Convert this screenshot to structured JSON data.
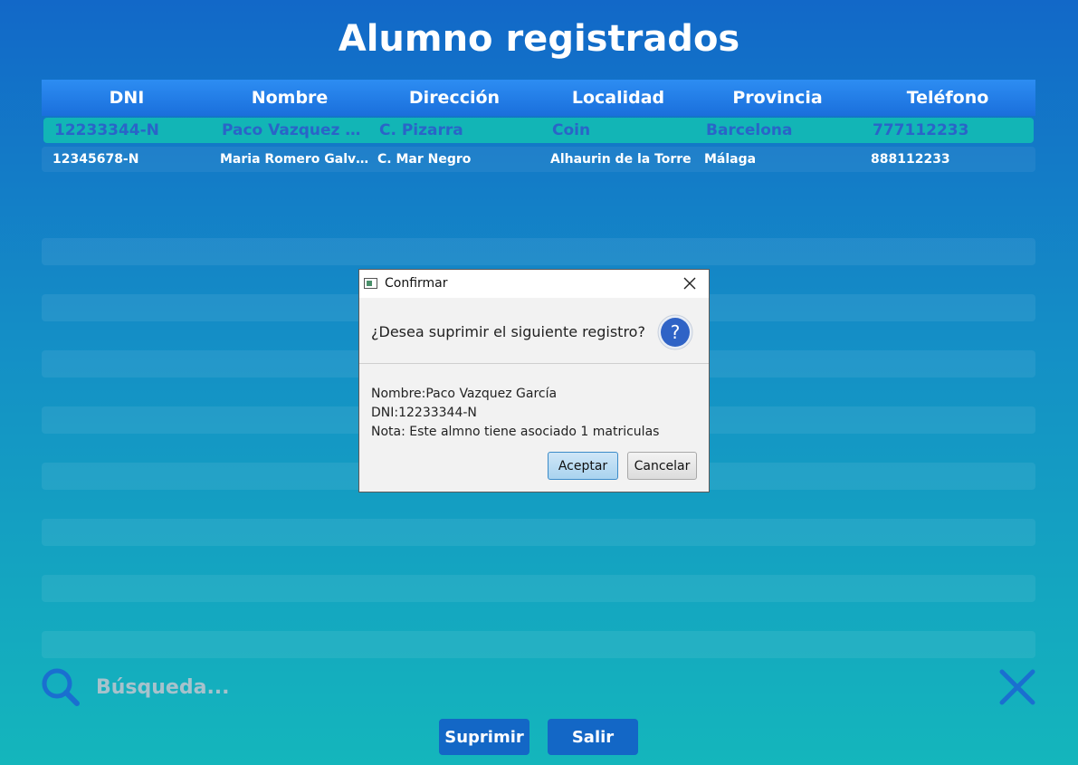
{
  "page": {
    "title": "Alumno registrados"
  },
  "table": {
    "columns": [
      "DNI",
      "Nombre",
      "Dirección",
      "Localidad",
      "Provincia",
      "Teléfono"
    ],
    "rows": [
      {
        "dni": "12233344-N",
        "nombre": "Paco Vazquez Ga...",
        "direccion": "C. Pizarra",
        "localidad": "Coin",
        "provincia": "Barcelona",
        "telefono": "777112233",
        "selected": true
      },
      {
        "dni": "12345678-N",
        "nombre": "Maria Romero Galvez",
        "direccion": "C. Mar Negro",
        "localidad": "Alhaurin de la Torre",
        "provincia": "Málaga",
        "telefono": "888112233",
        "selected": false
      }
    ]
  },
  "search": {
    "placeholder": "Búsqueda...",
    "value": ""
  },
  "buttons": {
    "delete": "Suprimir",
    "exit": "Salir"
  },
  "dialog": {
    "title": "Confirmar",
    "question": "¿Desea suprimir el siguiente registro?",
    "lines": [
      "Nombre:Paco Vazquez García",
      "DNI:12233344-N",
      "Nota: Este almno tiene asociado 1 matriculas"
    ],
    "ok": "Aceptar",
    "cancel": "Cancelar"
  },
  "icons": {
    "search": "search-icon",
    "clear": "close-icon",
    "question": "question-icon",
    "window": "app-window-icon"
  },
  "colors": {
    "accent": "#1367c6",
    "selected_row": "#12b5b6",
    "selected_text": "#2a64c8"
  }
}
